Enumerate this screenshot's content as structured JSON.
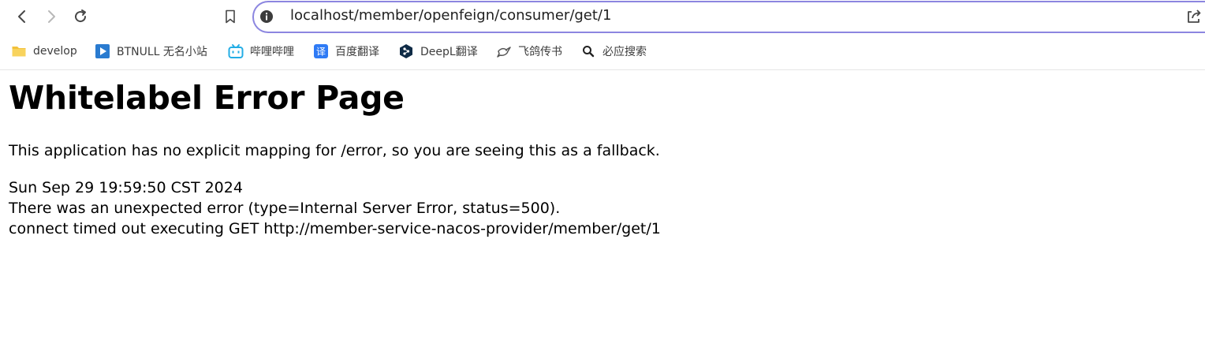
{
  "browser": {
    "url": "localhost/member/openfeign/consumer/get/1",
    "bookmarks": [
      {
        "label": "develop",
        "icon": "folder-icon"
      },
      {
        "label": "BTNULL 无名小站",
        "icon": "play-icon"
      },
      {
        "label": "哔哩哔哩",
        "icon": "bilibili-icon"
      },
      {
        "label": "百度翻译",
        "icon": "translate-icon"
      },
      {
        "label": "DeepL翻译",
        "icon": "deepl-icon"
      },
      {
        "label": "飞鸽传书",
        "icon": "pigeon-icon"
      },
      {
        "label": "必应搜索",
        "icon": "search-icon"
      }
    ]
  },
  "page": {
    "title": "Whitelabel Error Page",
    "message": "This application has no explicit mapping for /error, so you are seeing this as a fallback.",
    "timestamp": "Sun Sep 29 19:59:50 CST 2024",
    "error_line": "There was an unexpected error (type=Internal Server Error, status=500).",
    "detail_line": "connect timed out executing GET http://member-service-nacos-provider/member/get/1"
  }
}
